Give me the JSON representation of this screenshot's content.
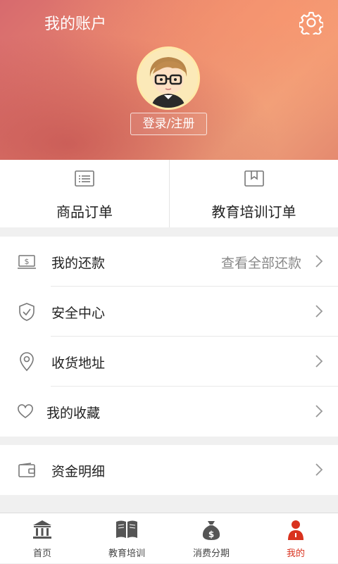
{
  "header": {
    "title": "我的账户",
    "login_label": "登录/注册",
    "settings_icon": "gear-icon"
  },
  "orders": [
    {
      "label": "商品订单",
      "icon": "list-icon"
    },
    {
      "label": "教育培训订单",
      "icon": "bookmark-book-icon"
    }
  ],
  "menu_group_1": [
    {
      "label": "我的还款",
      "extra": "查看全部还款",
      "icon": "dollar-screen-icon"
    },
    {
      "label": "安全中心",
      "icon": "shield-check-icon"
    },
    {
      "label": "收货地址",
      "icon": "location-pin-icon"
    },
    {
      "label": "我的收藏",
      "icon": "heart-icon"
    }
  ],
  "menu_group_2": [
    {
      "label": "资金明细",
      "icon": "wallet-icon"
    }
  ],
  "bottom_nav": [
    {
      "label": "首页",
      "icon": "bank-icon"
    },
    {
      "label": "教育培训",
      "icon": "book-icon"
    },
    {
      "label": "消费分期",
      "icon": "money-bag-icon"
    },
    {
      "label": "我的",
      "icon": "user-icon",
      "active": true
    }
  ],
  "colors": {
    "accent": "#d9321e",
    "header_gradient_start": "#d76a6e",
    "header_gradient_end": "#f0a27b"
  }
}
